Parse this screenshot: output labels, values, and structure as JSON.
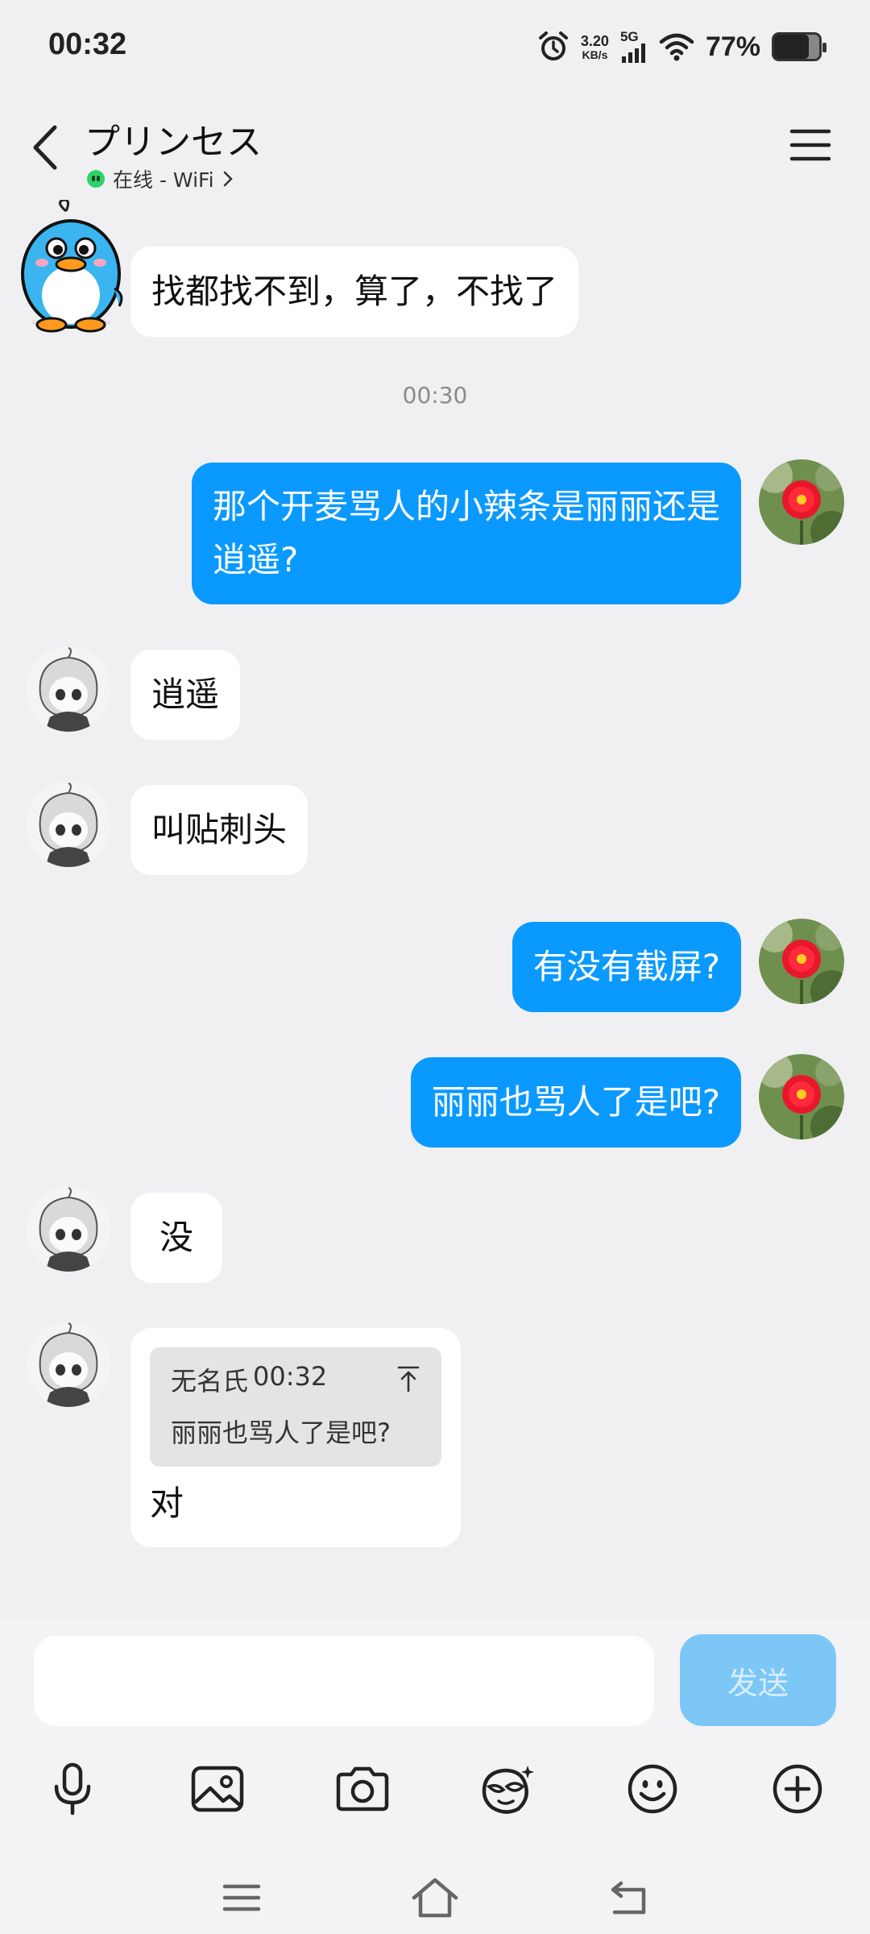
{
  "status_bar": {
    "time": "00:32",
    "speed_value": "3.20",
    "speed_unit": "KB/s",
    "network": "5G",
    "battery_percent": "77%",
    "battery_level": 0.77
  },
  "header": {
    "contact_name": "プリンセス",
    "online_status": "在线 - WiFi",
    "online_color": "#2fd26b"
  },
  "messages": [
    {
      "side": "in",
      "avatar": "penguin-avatar",
      "text": "找都找不到，算了，不找了"
    },
    {
      "type": "timestamp",
      "text": "00:30"
    },
    {
      "side": "out",
      "avatar": "flower-avatar",
      "lines": [
        "那个开麦骂人的小辣条是丽丽还是",
        "逍遥?"
      ]
    },
    {
      "side": "in",
      "avatar": "anime-girl-avatar",
      "text": "逍遥"
    },
    {
      "side": "in",
      "avatar": "anime-girl-avatar",
      "text": "叫贴刺头"
    },
    {
      "side": "out",
      "avatar": "flower-avatar",
      "text": "有没有截屏?"
    },
    {
      "side": "out",
      "avatar": "flower-avatar",
      "text": "丽丽也骂人了是吧?"
    },
    {
      "side": "in",
      "avatar": "anime-girl-avatar",
      "text": "没"
    },
    {
      "side": "in",
      "avatar": "anime-girl-avatar",
      "quote": {
        "sender": "无名氏",
        "time": "00:32",
        "text": "丽丽也骂人了是吧?"
      },
      "text": "对"
    }
  ],
  "composer": {
    "input_value": "",
    "send_label": "发送"
  },
  "toolbar_icons": [
    "microphone-icon",
    "image-icon",
    "camera-icon",
    "magic-face-icon",
    "emoji-icon",
    "plus-icon"
  ],
  "navbar_icons": [
    "menu-icon",
    "home-icon",
    "back-icon"
  ],
  "colors": {
    "outgoing_bubble": "#0a99ff",
    "incoming_bubble": "#ffffff",
    "background": "#f0f0f2",
    "send_button": "#7dc7f7"
  }
}
